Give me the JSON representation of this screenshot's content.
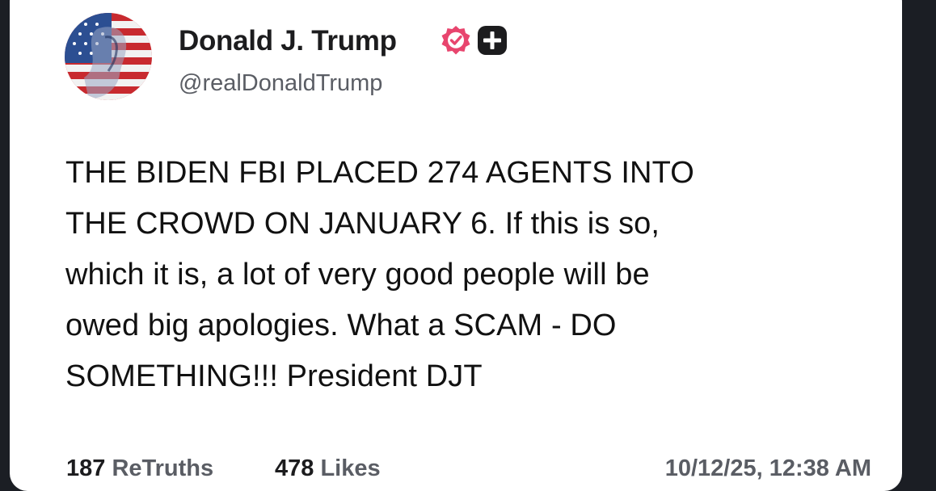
{
  "post": {
    "author": {
      "display_name": "Donald J. Trump",
      "handle": "@realDonaldTrump",
      "verified_icon": "verified-badge-icon",
      "verified_color": "#e8456e",
      "extra_icon": "plus-square-icon"
    },
    "text_lines": [
      "THE BIDEN FBI PLACED 274 AGENTS INTO",
      "THE CROWD ON JANUARY 6. If this is so,",
      "which it is, a lot of very good people will be",
      "owed big apologies. What a SCAM - DO",
      "SOMETHING!!! President DJT"
    ],
    "stats": {
      "retruths_count": "187",
      "retruths_label": "ReTruths",
      "likes_count": "478",
      "likes_label": "Likes"
    },
    "timestamp": "10/12/25, 12:38 AM"
  },
  "colors": {
    "background": "#1b1e24",
    "card": "#ffffff",
    "text_primary": "#111111",
    "text_secondary": "#5a5d64"
  }
}
